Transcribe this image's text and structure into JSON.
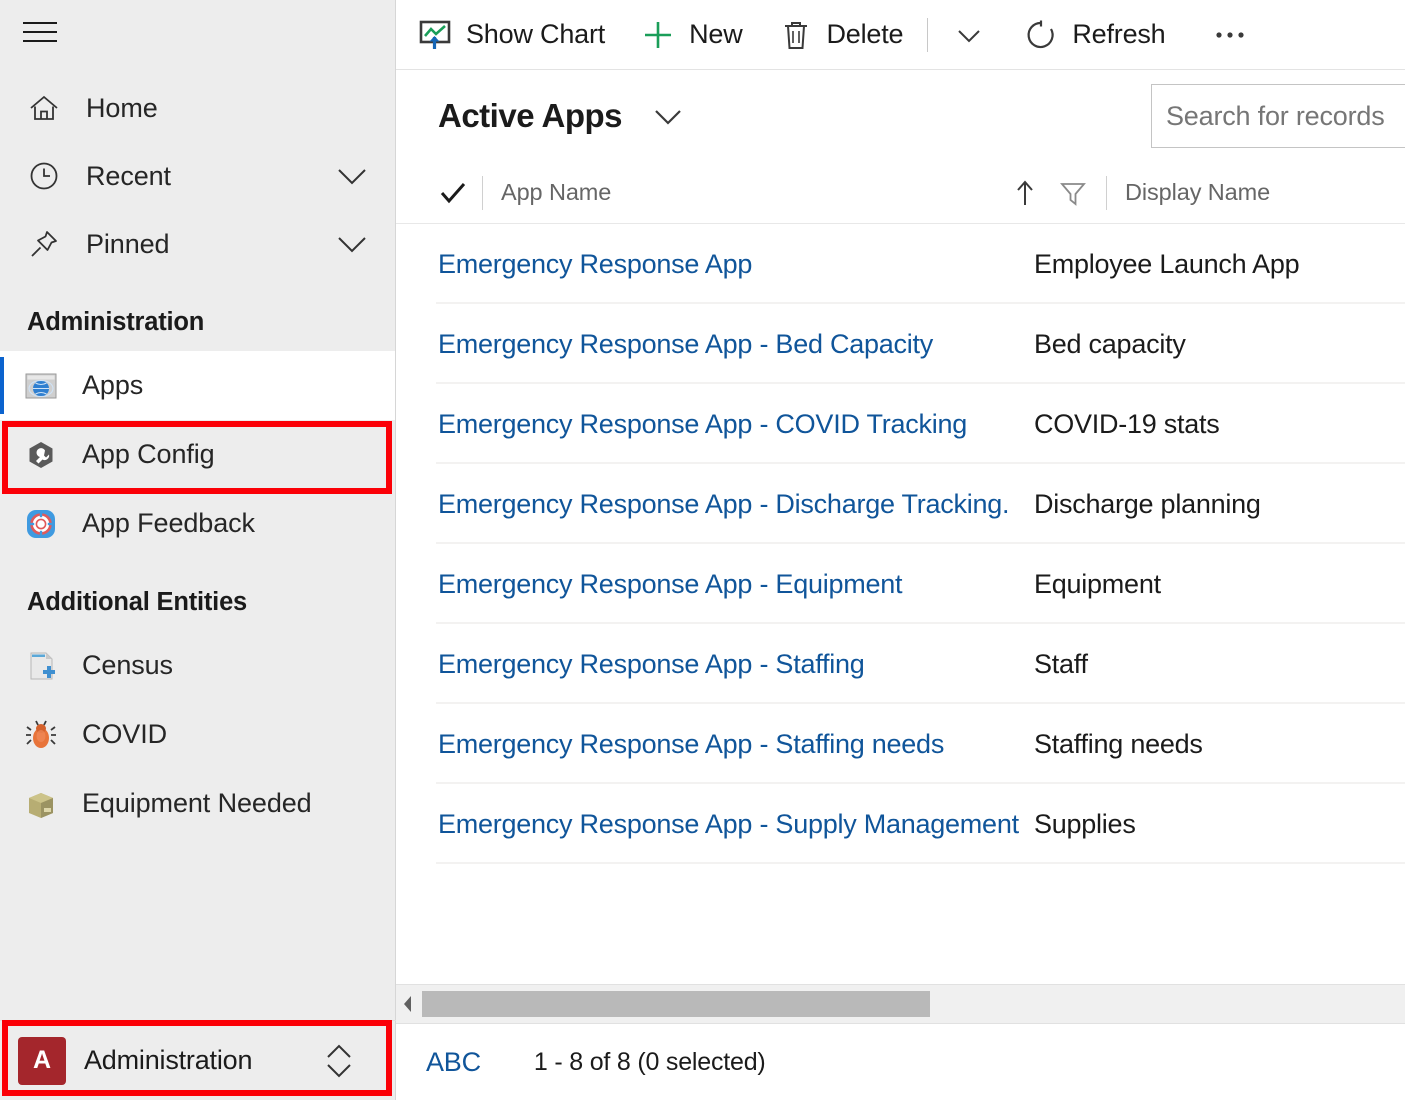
{
  "sidebar": {
    "hamburger_label": "Site Map",
    "nav": [
      {
        "label": "Home",
        "icon": "home-icon",
        "chevron": false
      },
      {
        "label": "Recent",
        "icon": "clock-icon",
        "chevron": true
      },
      {
        "label": "Pinned",
        "icon": "pin-icon",
        "chevron": true
      }
    ],
    "groups": [
      {
        "title": "Administration",
        "items": [
          {
            "label": "Apps",
            "icon": "globe-window-icon",
            "selected": true
          },
          {
            "label": "App Config",
            "icon": "hexagon-wrench-icon",
            "selected": false
          },
          {
            "label": "App Feedback",
            "icon": "lifebuoy-icon",
            "selected": false
          }
        ]
      },
      {
        "title": "Additional Entities",
        "items": [
          {
            "label": "Census",
            "icon": "document-plus-icon",
            "selected": false
          },
          {
            "label": "COVID",
            "icon": "bug-icon",
            "selected": false
          },
          {
            "label": "Equipment Needed",
            "icon": "box-icon",
            "selected": false
          }
        ]
      }
    ],
    "area_picker": {
      "badge": "A",
      "label": "Administration",
      "icon": "up-down-chevron-icon"
    }
  },
  "commandbar": {
    "items": [
      {
        "label": "Show Chart",
        "icon": "show-chart-icon"
      },
      {
        "label": "New",
        "icon": "plus-icon"
      },
      {
        "label": "Delete",
        "icon": "trash-icon"
      },
      {
        "label": "",
        "icon": "chevron-down-icon"
      },
      {
        "label": "Refresh",
        "icon": "refresh-icon"
      },
      {
        "label": "",
        "icon": "overflow-ellipsis-icon"
      }
    ],
    "show_chart_label": "Show Chart",
    "new_label": "New",
    "delete_label": "Delete",
    "refresh_label": "Refresh"
  },
  "view": {
    "name": "Active Apps",
    "chevron_icon": "chevron-down-icon"
  },
  "search": {
    "placeholder": "Search for records",
    "value": ""
  },
  "grid": {
    "columns": [
      "App Name",
      "Display Name"
    ],
    "sort_icon": "sort-ascending-icon",
    "filter_icon": "filter-funnel-icon",
    "select_all_icon": "checkmark-icon",
    "rows": [
      {
        "app_name": "Emergency Response App",
        "display_name": "Employee Launch App"
      },
      {
        "app_name": "Emergency Response App - Bed Capacity",
        "display_name": "Bed capacity"
      },
      {
        "app_name": "Emergency Response App - COVID Tracking",
        "display_name": "COVID-19 stats"
      },
      {
        "app_name": "Emergency Response App - Discharge Tracking.",
        "display_name": "Discharge planning"
      },
      {
        "app_name": "Emergency Response App - Equipment",
        "display_name": "Equipment"
      },
      {
        "app_name": "Emergency Response App - Staffing",
        "display_name": "Staff"
      },
      {
        "app_name": "Emergency Response App - Staffing needs",
        "display_name": "Staffing needs"
      },
      {
        "app_name": "Emergency Response App - Supply Management",
        "display_name": "Supplies"
      }
    ]
  },
  "status": {
    "alpha_index": "ABC",
    "record_count": "1 - 8 of 8 (0 selected)"
  },
  "colors": {
    "link": "#10559a",
    "accent_selection": "#0b63ce",
    "annotation_red": "#fb0007",
    "area_badge": "#a4262c",
    "sidebar_bg": "#ededed"
  }
}
